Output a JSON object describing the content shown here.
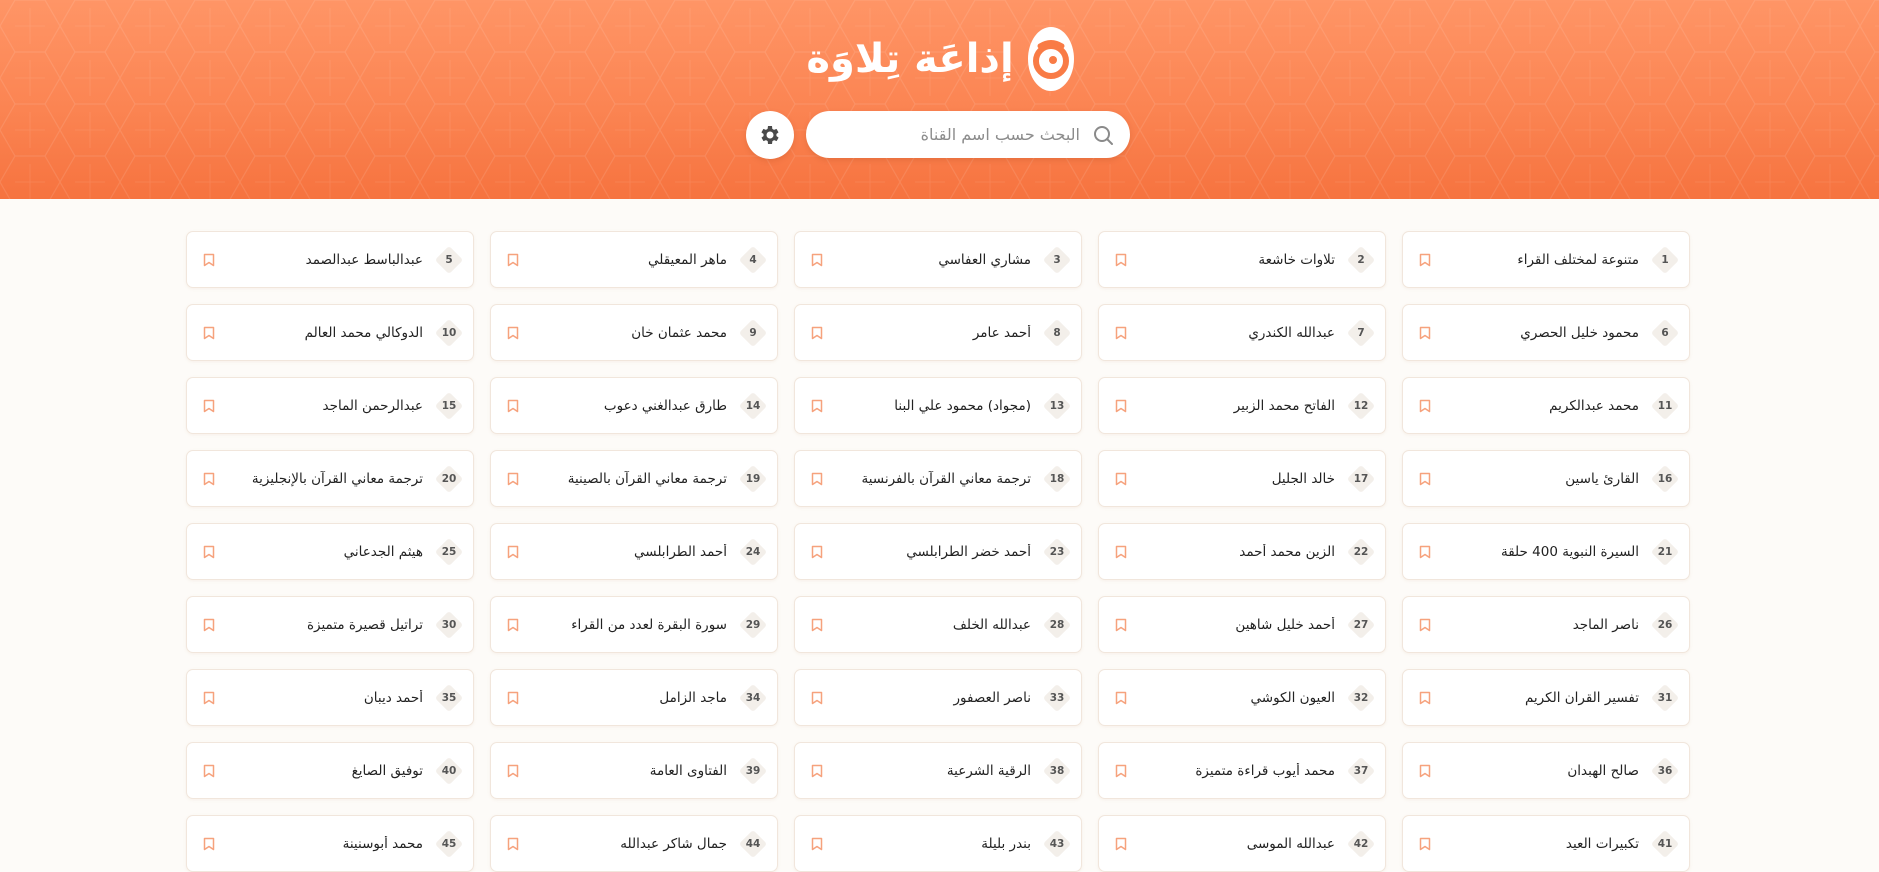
{
  "header": {
    "title": "إذاعَة تِلاوَة",
    "logo_icon": "tilawa-logo-icon",
    "accent": "#fb8452"
  },
  "search": {
    "placeholder": "البحث حسب اسم القناة",
    "value": "",
    "icon": "search-icon"
  },
  "settings": {
    "icon": "gear-icon"
  },
  "channels": [
    {
      "num": "1",
      "name": "متنوعة لمختلف القراء"
    },
    {
      "num": "2",
      "name": "تلاوات خاشعة"
    },
    {
      "num": "3",
      "name": "مشاري العفاسي"
    },
    {
      "num": "4",
      "name": "ماهر المعيقلي"
    },
    {
      "num": "5",
      "name": "عبدالباسط عبدالصمد"
    },
    {
      "num": "6",
      "name": "محمود خليل الحصري"
    },
    {
      "num": "7",
      "name": "عبدالله الكندري"
    },
    {
      "num": "8",
      "name": "أحمد عامر"
    },
    {
      "num": "9",
      "name": "محمد عثمان خان"
    },
    {
      "num": "10",
      "name": "الدوكالي محمد العالم"
    },
    {
      "num": "11",
      "name": "محمد عبدالكريم"
    },
    {
      "num": "12",
      "name": "الفاتح محمد الزبير"
    },
    {
      "num": "13",
      "name": "(مجواد) محمود علي البنا"
    },
    {
      "num": "14",
      "name": "طارق عبدالغني دعوب"
    },
    {
      "num": "15",
      "name": "عبدالرحمن الماجد"
    },
    {
      "num": "16",
      "name": "القارئ ياسين"
    },
    {
      "num": "17",
      "name": "خالد الجليل"
    },
    {
      "num": "18",
      "name": "ترجمة معاني القرآن بالفرنسية"
    },
    {
      "num": "19",
      "name": "ترجمة معاني القرآن بالصينية"
    },
    {
      "num": "20",
      "name": "ترجمة معاني القرآن بالإنجليزية"
    },
    {
      "num": "21",
      "name": "السيرة النبوية 400 حلقة"
    },
    {
      "num": "22",
      "name": "الزين محمد أحمد"
    },
    {
      "num": "23",
      "name": "أحمد خضر الطرابلسي"
    },
    {
      "num": "24",
      "name": "أحمد الطرابلسي"
    },
    {
      "num": "25",
      "name": "هيثم الجدعاني"
    },
    {
      "num": "26",
      "name": "ناصر الماجد"
    },
    {
      "num": "27",
      "name": "أحمد خليل شاهين"
    },
    {
      "num": "28",
      "name": "عبدالله الخلف"
    },
    {
      "num": "29",
      "name": "سورة البقرة لعدد من القراء"
    },
    {
      "num": "30",
      "name": "تراتيل قصيرة متميزة"
    },
    {
      "num": "31",
      "name": "تفسير القران الكريم"
    },
    {
      "num": "32",
      "name": "العيون الكوشي"
    },
    {
      "num": "33",
      "name": "ناصر العصفور"
    },
    {
      "num": "34",
      "name": "ماجد الزامل"
    },
    {
      "num": "35",
      "name": "أحمد ديبان"
    },
    {
      "num": "36",
      "name": "صالح الهبدان"
    },
    {
      "num": "37",
      "name": "محمد أيوب قراءة متميزة"
    },
    {
      "num": "38",
      "name": "الرقية الشرعية"
    },
    {
      "num": "39",
      "name": "الفتاوى العامة"
    },
    {
      "num": "40",
      "name": "توفيق الصايغ"
    },
    {
      "num": "41",
      "name": "تكبيرات العيد"
    },
    {
      "num": "42",
      "name": "عبدالله الموسى"
    },
    {
      "num": "43",
      "name": "بندر بليلة"
    },
    {
      "num": "44",
      "name": "جمال شاكر عبدالله"
    },
    {
      "num": "45",
      "name": "محمد أبوسنينة"
    }
  ]
}
